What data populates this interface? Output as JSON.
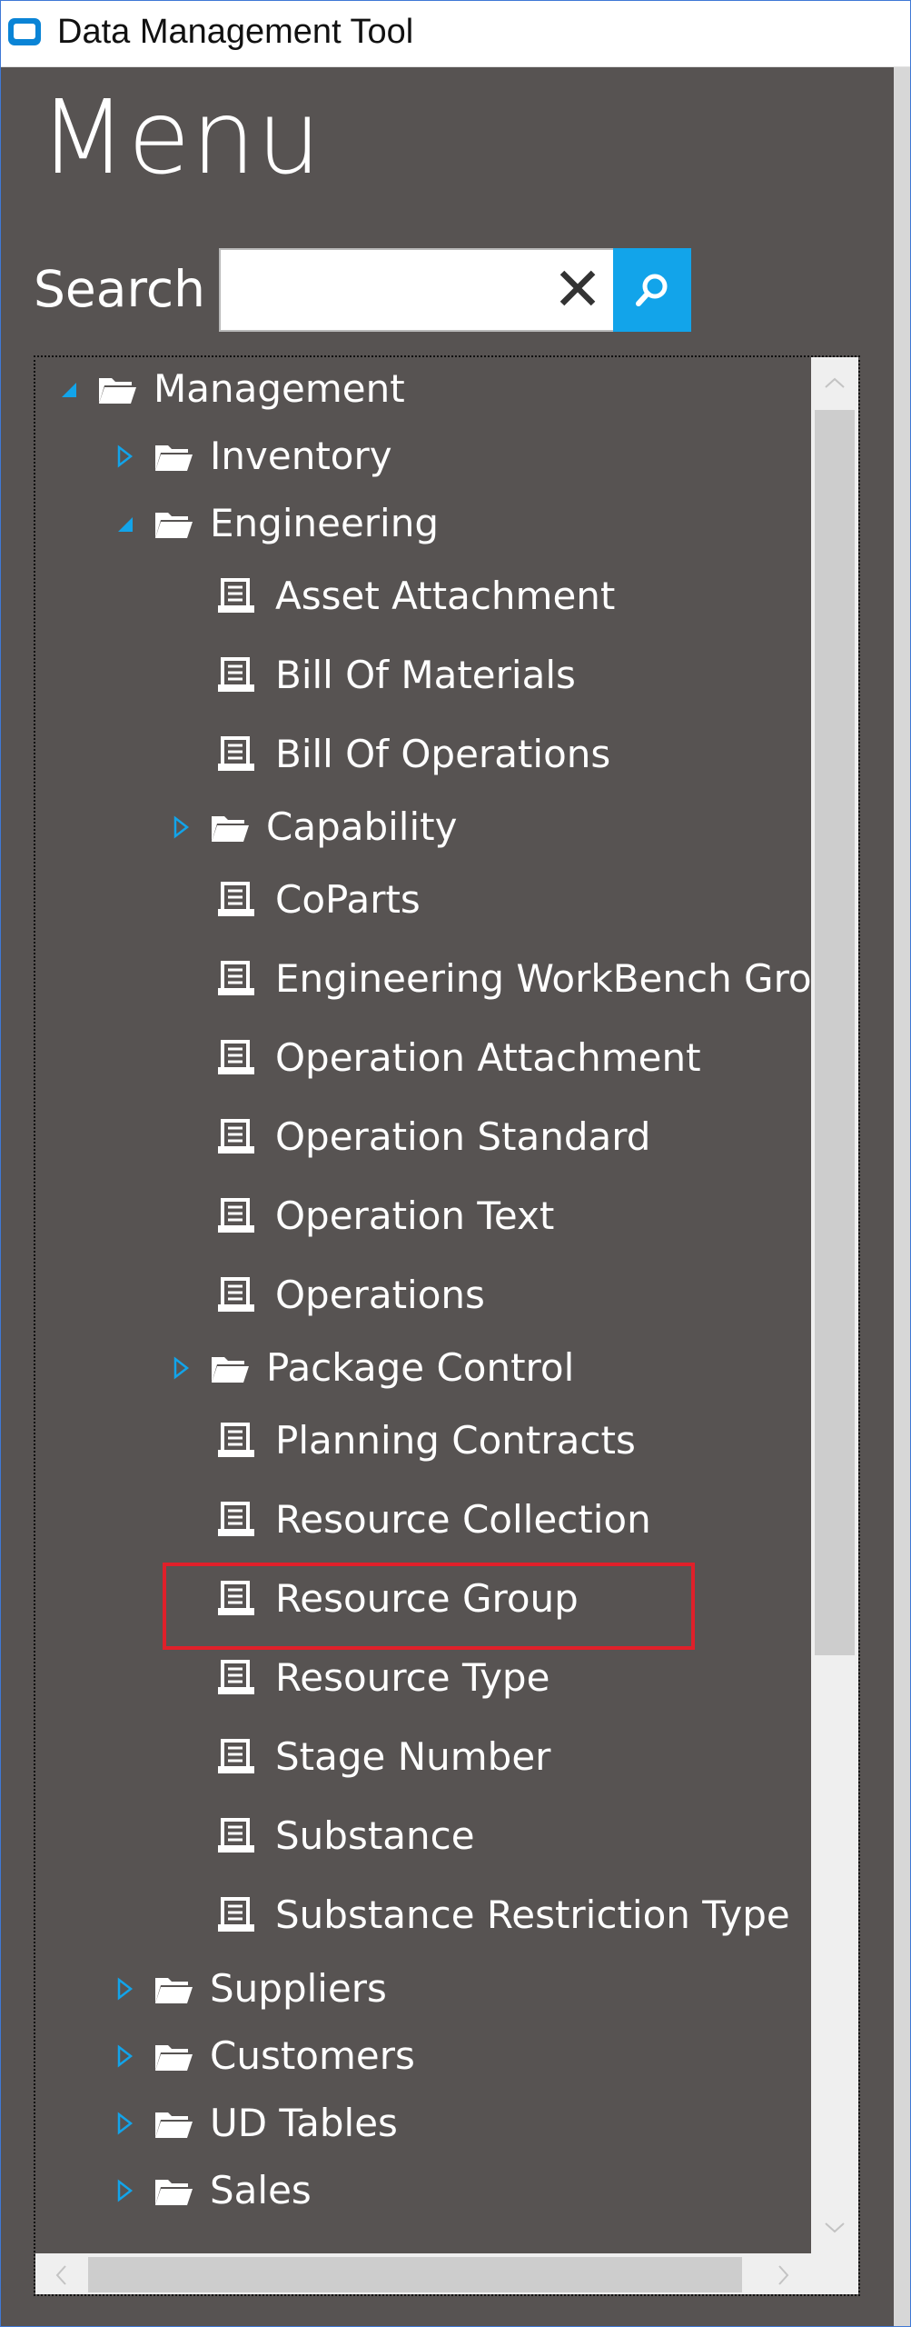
{
  "window": {
    "title": "Data Management Tool"
  },
  "menu": {
    "heading": "Menu"
  },
  "search": {
    "label": "Search",
    "value": "",
    "placeholder": ""
  },
  "tree": {
    "root": {
      "label": "Management",
      "expanded": true
    },
    "inventory": {
      "label": "Inventory",
      "expanded": false
    },
    "engineering": {
      "label": "Engineering",
      "expanded": true,
      "children": [
        {
          "label": "Asset Attachment",
          "kind": "document"
        },
        {
          "label": "Bill Of Materials",
          "kind": "document"
        },
        {
          "label": "Bill Of Operations",
          "kind": "document"
        },
        {
          "label": "Capability",
          "kind": "folder",
          "expanded": false
        },
        {
          "label": "CoParts",
          "kind": "document"
        },
        {
          "label": "Engineering WorkBench Group",
          "kind": "document"
        },
        {
          "label": "Operation Attachment",
          "kind": "document"
        },
        {
          "label": "Operation Standard",
          "kind": "document"
        },
        {
          "label": "Operation Text",
          "kind": "document"
        },
        {
          "label": "Operations",
          "kind": "document"
        },
        {
          "label": "Package Control",
          "kind": "folder",
          "expanded": false
        },
        {
          "label": "Planning Contracts",
          "kind": "document"
        },
        {
          "label": "Resource Collection",
          "kind": "document"
        },
        {
          "label": "Resource Group",
          "kind": "document",
          "highlighted": true
        },
        {
          "label": "Resource Type",
          "kind": "document"
        },
        {
          "label": "Stage Number",
          "kind": "document"
        },
        {
          "label": "Substance",
          "kind": "document"
        },
        {
          "label": "Substance Restriction Type",
          "kind": "document"
        }
      ]
    },
    "siblings": [
      {
        "label": "Suppliers",
        "expanded": false
      },
      {
        "label": "Customers",
        "expanded": false
      },
      {
        "label": "UD Tables",
        "expanded": false
      },
      {
        "label": "Sales",
        "expanded": false
      }
    ]
  },
  "colors": {
    "background": "#575352",
    "accent": "#12a4ea",
    "highlight_border": "#e0202a",
    "text": "#ffffff"
  },
  "icons": {
    "folder": "folder-icon",
    "document": "document-icon",
    "expanded": "expanded-triangle-icon",
    "collapsed": "collapsed-triangle-icon",
    "search": "search-icon",
    "clear": "clear-icon"
  }
}
